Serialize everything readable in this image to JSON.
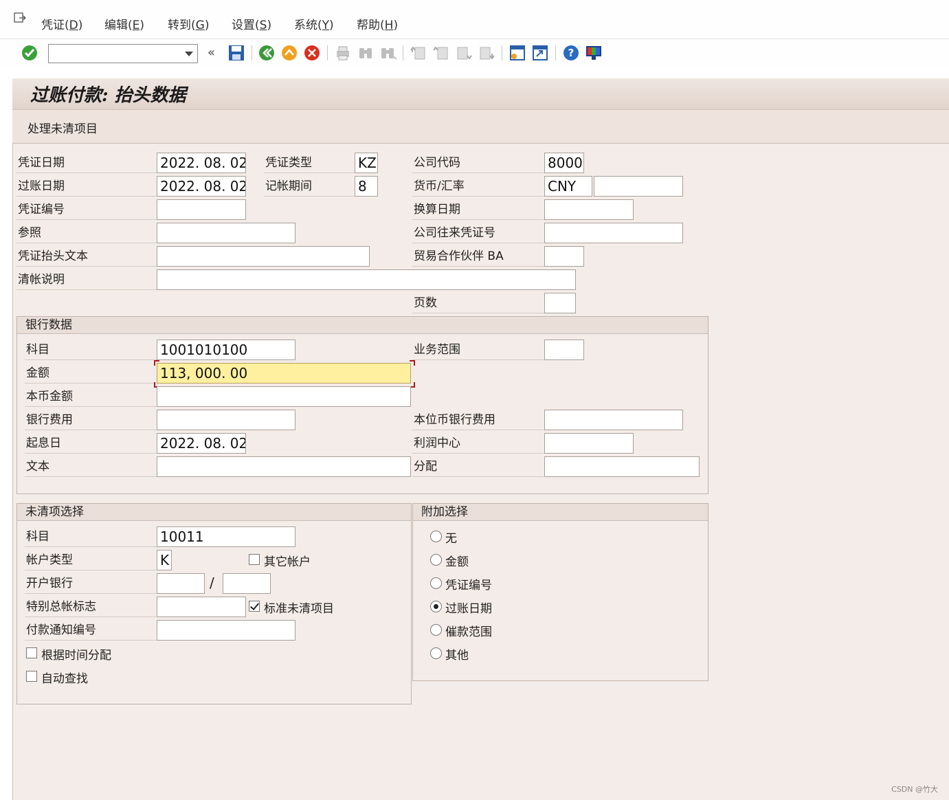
{
  "menu": [
    {
      "label": "凭证(",
      "key": "D",
      "tail": ")"
    },
    {
      "label": "编辑(",
      "key": "E",
      "tail": ")"
    },
    {
      "label": "转到(",
      "key": "G",
      "tail": ")"
    },
    {
      "label": "设置(",
      "key": "S",
      "tail": ")"
    },
    {
      "label": "系统(",
      "key": "Y",
      "tail": ")"
    },
    {
      "label": "帮助(",
      "key": "H",
      "tail": ")"
    }
  ],
  "toolbar": {
    "command_value": "",
    "back_glyph": "«"
  },
  "page_title": "过账付款: 抬头数据",
  "app_toolbar": {
    "open_items_label": "处理未清项目"
  },
  "header": {
    "doc_date_label": "凭证日期",
    "doc_date": "2022. 08. 02",
    "doc_type_label": "凭证类型",
    "doc_type": "KZ",
    "company_code_label": "公司代码",
    "company_code": "8000",
    "posting_date_label": "过账日期",
    "posting_date": "2022. 08. 02",
    "period_label": "记帐期间",
    "period": "8",
    "currency_label": "货币/汇率",
    "currency": "CNY",
    "exchange_rate": "",
    "doc_number_label": "凭证编号",
    "doc_number": "",
    "translation_date_label": "换算日期",
    "translation_date": "",
    "reference_label": "参照",
    "reference": "",
    "intercompany_label": "公司往来凭证号",
    "intercompany": "",
    "header_text_label": "凭证抬头文本",
    "header_text": "",
    "trading_partner_label": "贸易合作伙伴 BA",
    "trading_partner": "",
    "clearing_text_label": "清帐说明",
    "clearing_text": "",
    "pages_label": "页数",
    "pages": ""
  },
  "bank": {
    "title": "银行数据",
    "account_label": "科目",
    "account": "1001010100",
    "business_area_label": "业务范围",
    "business_area": "",
    "amount_label": "金额",
    "amount": "113, 000. 00",
    "local_amount_label": "本币金额",
    "local_amount": "",
    "bank_charges_label": "银行费用",
    "bank_charges": "",
    "local_bank_charges_label": "本位币银行费用",
    "local_bank_charges": "",
    "value_date_label": "起息日",
    "value_date": "2022. 08. 02",
    "profit_center_label": "利润中心",
    "profit_center": "",
    "text_label": "文本",
    "text": "",
    "assignment_label": "分配",
    "assignment": ""
  },
  "open_items": {
    "title": "未清项选择",
    "account_label": "科目",
    "account": "10011",
    "account_type_label": "帐户类型",
    "account_type": "K",
    "other_accounts_label": "其它帐户",
    "other_accounts": false,
    "house_bank_label": "开户银行",
    "house_bank": "",
    "house_bank_sep": "/",
    "account_id": "",
    "special_gl_label": "特别总帐标志",
    "special_gl": "",
    "standard_oi_label": "标准未清项目",
    "standard_oi": true,
    "payment_advice_label": "付款通知编号",
    "payment_advice": "",
    "distribute_by_age_label": "根据时间分配",
    "distribute_by_age": false,
    "auto_search_label": "自动查找",
    "auto_search": false
  },
  "additional": {
    "title": "附加选择",
    "options": [
      {
        "label": "无",
        "selected": false
      },
      {
        "label": "金额",
        "selected": false
      },
      {
        "label": "凭证编号",
        "selected": false
      },
      {
        "label": "过账日期",
        "selected": true
      },
      {
        "label": "催款范围",
        "selected": false
      },
      {
        "label": "其他",
        "selected": false
      }
    ]
  },
  "watermark": "CSDN @竹大"
}
